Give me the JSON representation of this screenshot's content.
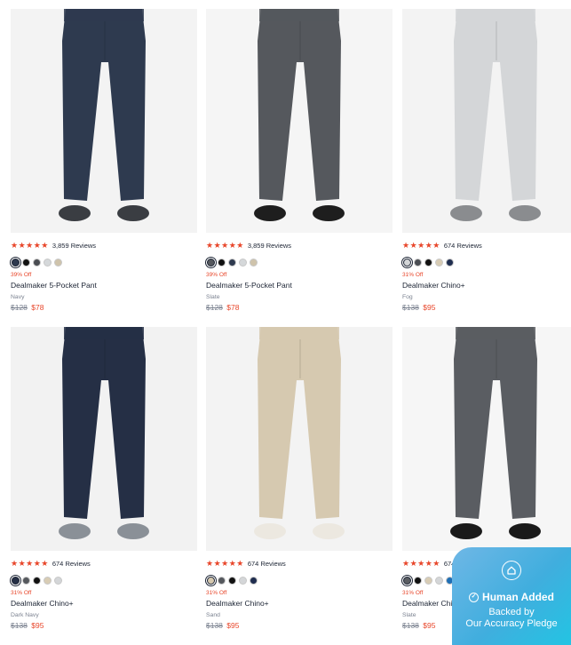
{
  "products": [
    {
      "rating_stars": "★★★★★",
      "reviews": "3,859 Reviews",
      "discount": "39% Off",
      "name": "Dealmaker 5-Pocket Pant",
      "color": "Navy",
      "orig_price": "$128",
      "sale_price": "$78",
      "pant_color": "#2e3a4f",
      "shoe_color": "#3a3d42",
      "bg": "#f3f3f3",
      "swatches": [
        "#2e3a4f",
        "#111111",
        "#4a4d52",
        "#d5d8da",
        "#cfc3ab"
      ],
      "selected": 0
    },
    {
      "rating_stars": "★★★★★",
      "reviews": "3,859 Reviews",
      "discount": "39% Off",
      "name": "Dealmaker 5-Pocket Pant",
      "color": "Slate",
      "orig_price": "$128",
      "sale_price": "$78",
      "pant_color": "#55585d",
      "shoe_color": "#1e1e1e",
      "bg": "#f5f5f5",
      "swatches": [
        "#55585d",
        "#111111",
        "#2e3a4f",
        "#d5d8da",
        "#cfc3ab"
      ],
      "selected": 0
    },
    {
      "rating_stars": "★★★★★",
      "reviews": "674 Reviews",
      "discount": "31% Off",
      "name": "Dealmaker Chino+",
      "color": "Fog",
      "orig_price": "$138",
      "sale_price": "$95",
      "pant_color": "#d4d6d8",
      "shoe_color": "#8a8c8f",
      "bg": "#f3f3f3",
      "swatches": [
        "#d4d6d8",
        "#4a4d52",
        "#111111",
        "#d8ccb4",
        "#1f2d4f"
      ],
      "selected": 0
    },
    {
      "rating_stars": "★★★★★",
      "reviews": "674 Reviews",
      "discount": "31% Off",
      "name": "Dealmaker Chino+",
      "color": "Dark Navy",
      "orig_price": "$138",
      "sale_price": "$95",
      "pant_color": "#252f45",
      "shoe_color": "#8a9097",
      "bg": "#f2f2f2",
      "swatches": [
        "#252f45",
        "#55585d",
        "#111111",
        "#d8ccb4",
        "#d4d6d8"
      ],
      "selected": 0
    },
    {
      "rating_stars": "★★★★★",
      "reviews": "674 Reviews",
      "discount": "31% Off",
      "name": "Dealmaker Chino+",
      "color": "Sand",
      "orig_price": "$138",
      "sale_price": "$95",
      "pant_color": "#d6c9b0",
      "shoe_color": "#ece8e0",
      "bg": "#f3f3f3",
      "swatches": [
        "#d6c9b0",
        "#55585d",
        "#111111",
        "#d4d6d8",
        "#1f2d4f"
      ],
      "selected": 0
    },
    {
      "rating_stars": "★★★★★",
      "reviews": "674 Reviews",
      "discount": "31% Off",
      "name": "Dealmaker Chino+",
      "color": "Slate",
      "orig_price": "$138",
      "sale_price": "$95",
      "pant_color": "#5a5d62",
      "shoe_color": "#1a1a1a",
      "bg": "#f6f6f6",
      "swatches": [
        "#5a5d62",
        "#111111",
        "#d8ccb4",
        "#d4d6d8",
        "#1f6fb5"
      ],
      "selected": 0
    }
  ],
  "badge": {
    "title": "Human Added",
    "line2": "Backed by",
    "line3": "Our Accuracy Pledge",
    "colors": {
      "from": "#6fb7e6",
      "to": "#23c4e3"
    }
  },
  "colors": {
    "accent": "#e8462a",
    "text": "#1b2333",
    "muted": "#7b8290"
  }
}
